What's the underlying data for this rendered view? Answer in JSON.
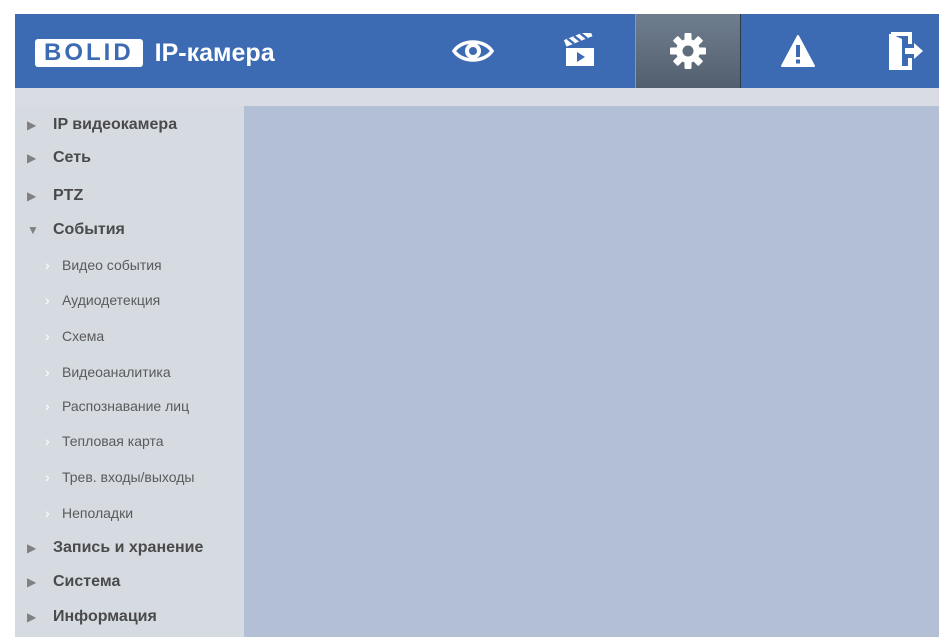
{
  "header": {
    "logo_text": "BOLID",
    "logo_subtitle": "IP-камера",
    "nav": [
      {
        "icon": "eye-icon",
        "id": "live-view"
      },
      {
        "icon": "clapperboard-icon",
        "id": "playback"
      },
      {
        "icon": "gear-icon",
        "id": "settings",
        "active": true
      },
      {
        "icon": "warning-icon",
        "id": "alarm"
      },
      {
        "icon": "exit-icon",
        "id": "logout"
      }
    ],
    "colors": {
      "bar": "#3d6bb3",
      "active": "#5f6c7b"
    }
  },
  "sidebar": {
    "items": [
      {
        "label": "IP видеокамера",
        "expanded": false
      },
      {
        "label": "Сеть",
        "expanded": false
      },
      {
        "label": "PTZ",
        "expanded": false
      },
      {
        "label": "События",
        "expanded": true,
        "children": [
          "Видео события",
          "Аудиодетекция",
          "Схема",
          "Видеоаналитика",
          "Распознавание лиц",
          "Тепловая карта",
          "Трев. входы/выходы",
          "Неполадки"
        ]
      },
      {
        "label": "Запись и хранение",
        "expanded": false
      },
      {
        "label": "Система",
        "expanded": false
      },
      {
        "label": "Информация",
        "expanded": false
      }
    ],
    "arrow_collapsed": "▶",
    "arrow_expanded": "▼",
    "sub_chevron": "›"
  },
  "main": {
    "background": "#b2bfd4"
  }
}
